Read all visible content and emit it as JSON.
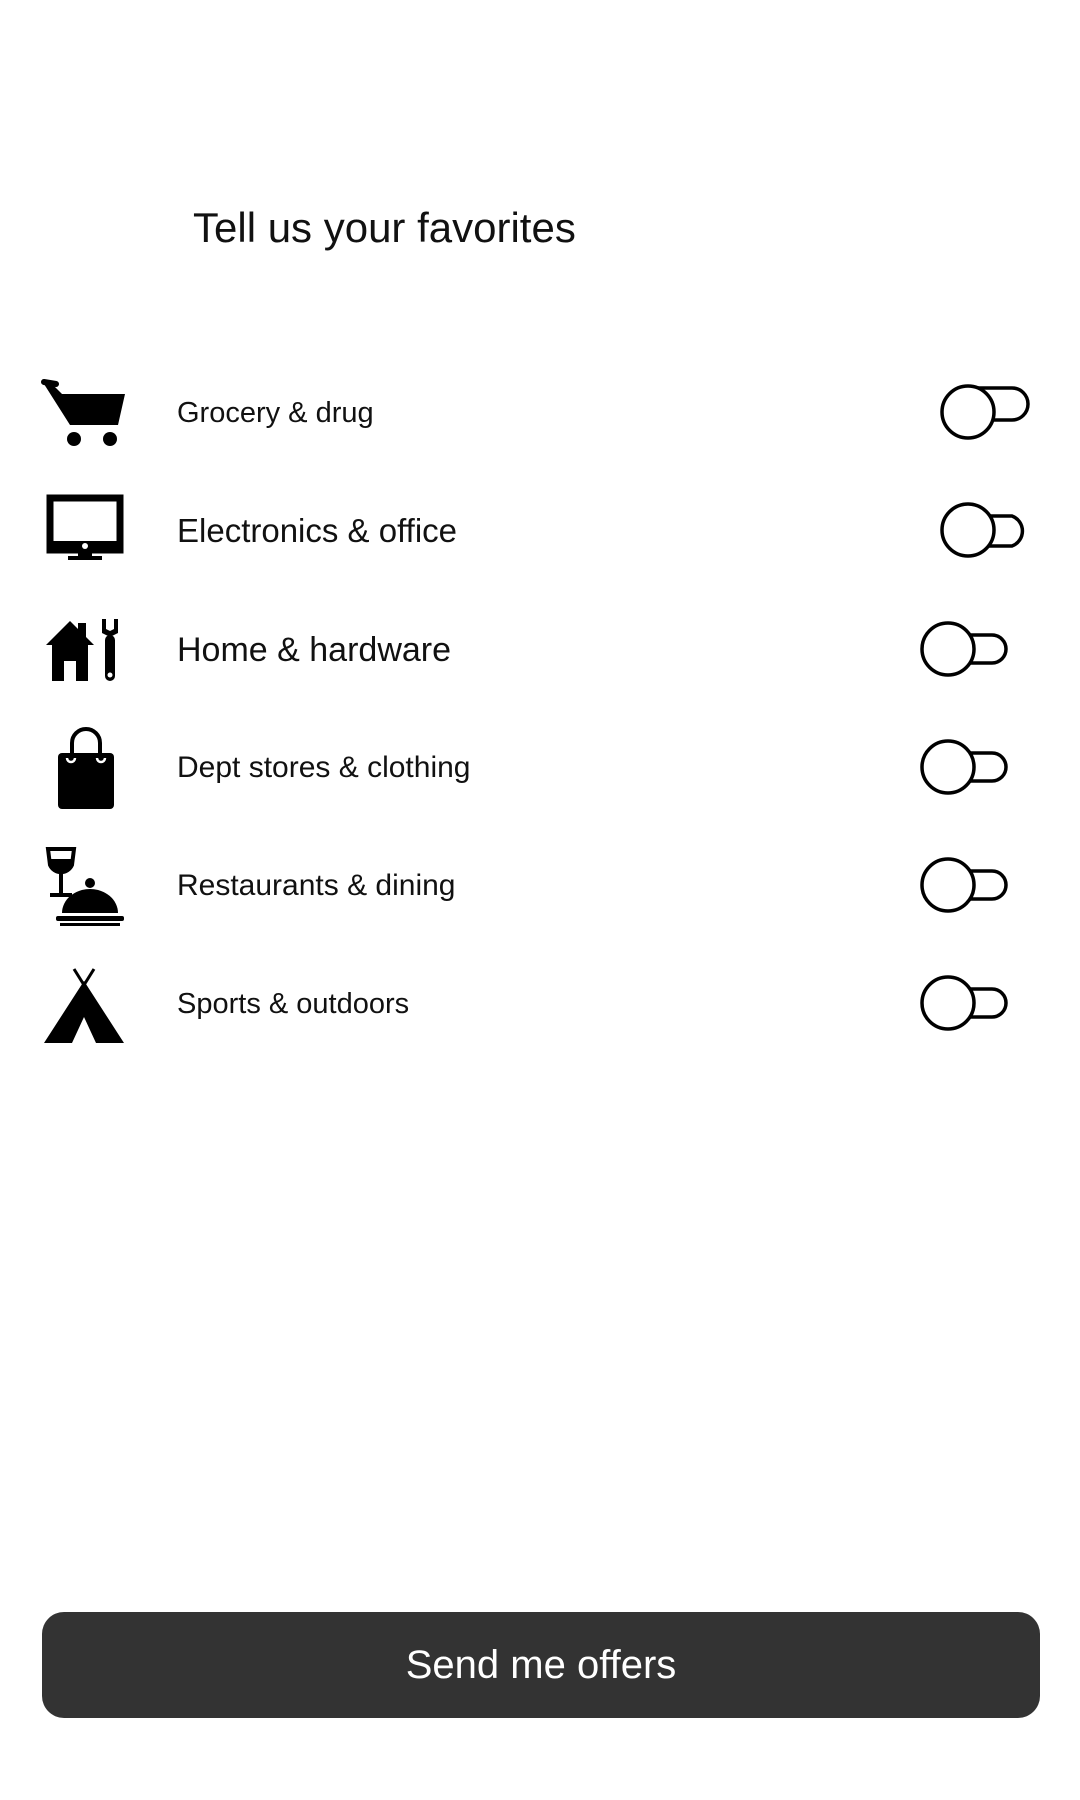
{
  "page": {
    "title": "Tell us your favorites"
  },
  "categories": [
    {
      "label": "Grocery & drug",
      "icon": "shopping-cart-icon",
      "enabled": false
    },
    {
      "label": "Electronics & office",
      "icon": "monitor-icon",
      "enabled": false
    },
    {
      "label": "Home & hardware",
      "icon": "house-wrench-icon",
      "enabled": false
    },
    {
      "label": "Dept stores & clothing",
      "icon": "shopping-bag-icon",
      "enabled": false
    },
    {
      "label": "Restaurants & dining",
      "icon": "wine-cloche-icon",
      "enabled": false
    },
    {
      "label": "Sports & outdoors",
      "icon": "tent-icon",
      "enabled": false
    }
  ],
  "footer": {
    "submit_label": "Send me offers"
  },
  "colors": {
    "button_background": "#333333",
    "button_text": "#ffffff",
    "text": "#111111",
    "background": "#ffffff"
  }
}
